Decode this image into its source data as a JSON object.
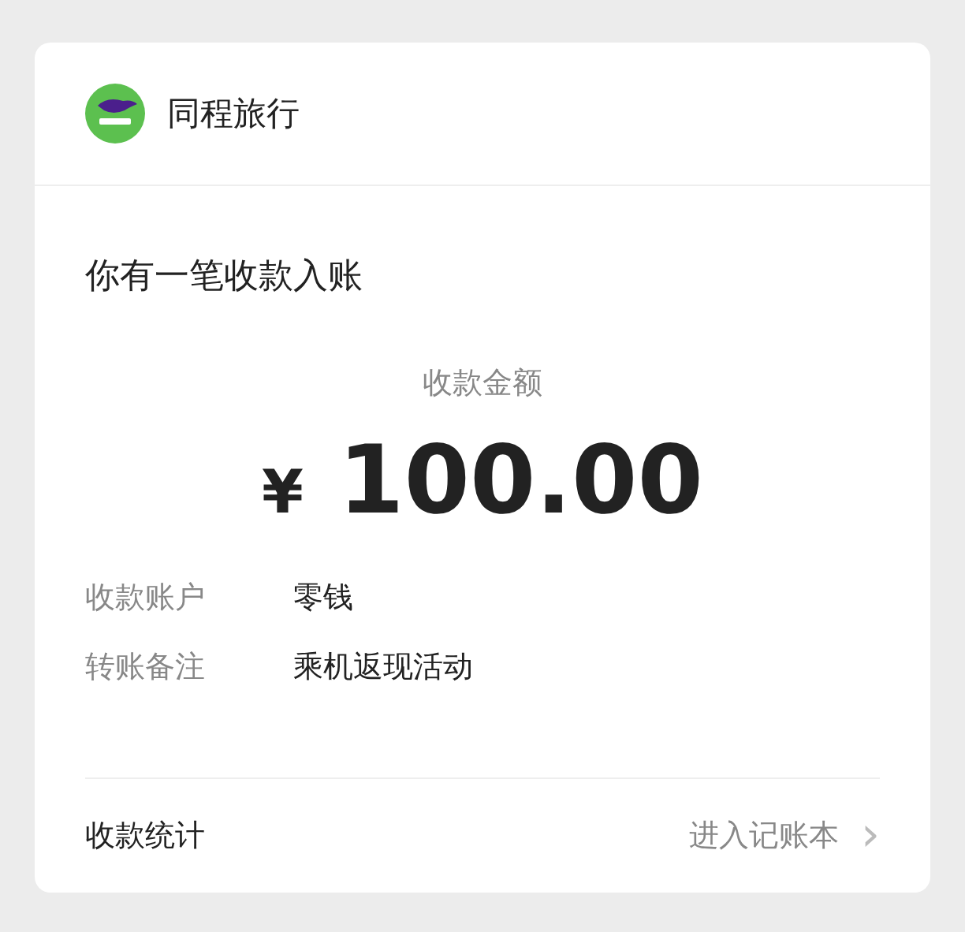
{
  "header": {
    "app_name": "同程旅行"
  },
  "notice": {
    "title": "你有一笔收款入账",
    "amount_label": "收款金额",
    "currency": "¥",
    "amount": "100.00"
  },
  "details": [
    {
      "label": "收款账户",
      "value": "零钱"
    },
    {
      "label": "转账备注",
      "value": "乘机返现活动"
    }
  ],
  "footer": {
    "label": "收款统计",
    "link": "进入记账本",
    "chevron": "›"
  }
}
